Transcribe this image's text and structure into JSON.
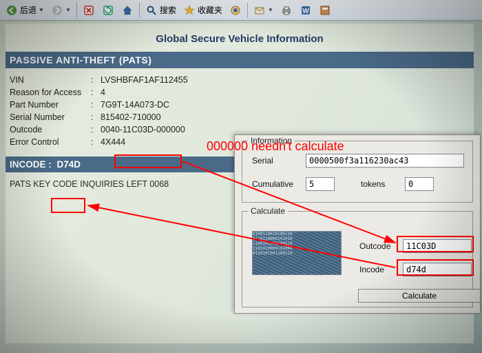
{
  "toolbar": {
    "back": "后退",
    "search": "搜索",
    "favorites": "收藏夹"
  },
  "page": {
    "title": "Global Secure Vehicle Information",
    "section": "PASSIVE ANTI-THEFT (PATS)",
    "rows": {
      "vin_label": "VIN",
      "vin_value": "LVSHBFAF1AF112455",
      "reason_label": "Reason for Access",
      "reason_value": "4",
      "part_label": "Part Number",
      "part_value": "7G9T-14A073-DC",
      "serial_label": "Serial Number",
      "serial_value_a": "815402-",
      "serial_value_b": "710000",
      "outcode_label": "Outcode",
      "outcode_value_a": "0040-",
      "outcode_value_b": "11C03D",
      "outcode_value_c": "-000000",
      "error_label": "Error Control",
      "error_value": "4X444"
    },
    "incode_label": "INCODE :",
    "incode_value": "D74D",
    "inquiries_label": "PATS KEY CODE INQUIRIES LEFT",
    "inquiries_value": "0068"
  },
  "dialog": {
    "grp1": "Information",
    "serial_label": "Serial",
    "serial_value": "0000500f3a116230ac43",
    "cumulative_label": "Cumulative",
    "cumulative_value": "5",
    "tokens_label": "tokens",
    "tokens_value": "0",
    "grp2": "Calculate",
    "outcode_label": "Outcode",
    "outcode_value": "11C03D",
    "incode_label": "Incode",
    "incode_value": "d74d",
    "calc_btn": "Calculate"
  },
  "annot": {
    "note": "000000 needn't calculate"
  }
}
